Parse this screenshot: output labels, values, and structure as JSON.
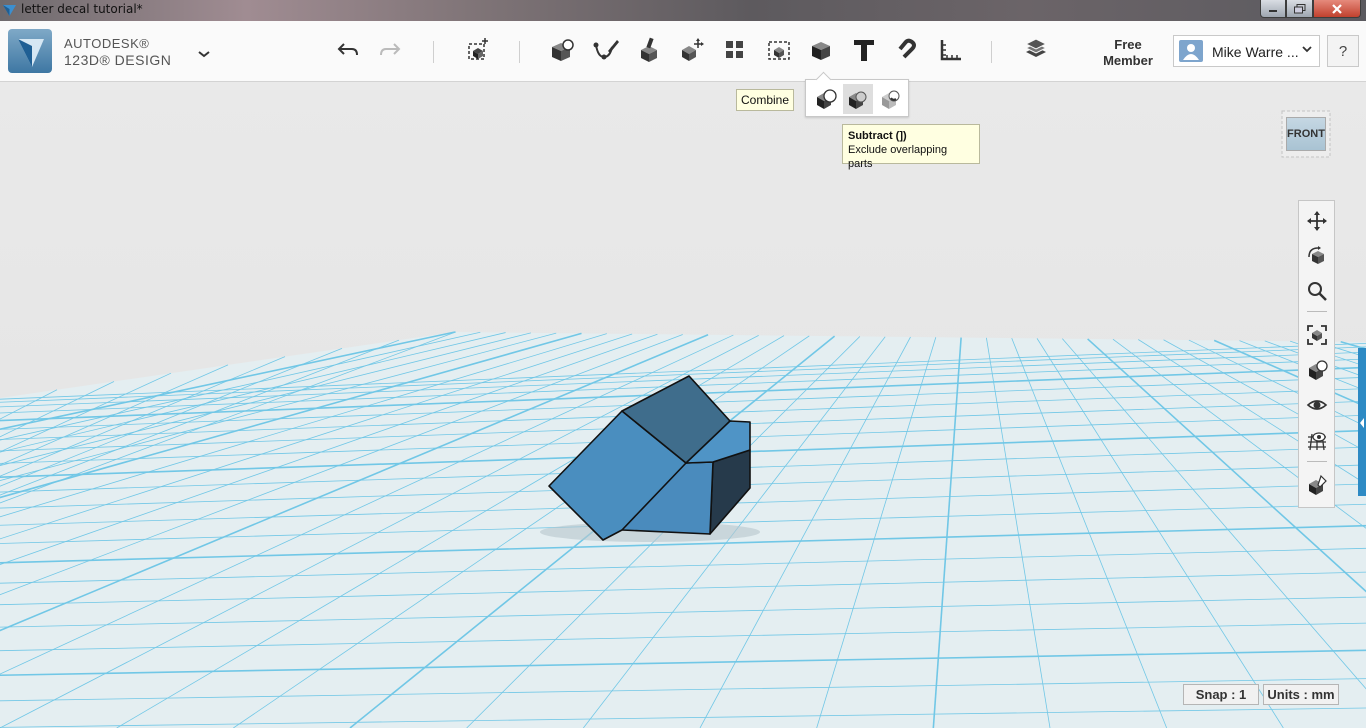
{
  "window": {
    "title": "letter decal tutorial*"
  },
  "brand": {
    "line1": "AUTODESK®",
    "line2": "123D® DESIGN"
  },
  "toolbar": {
    "tools": [
      {
        "name": "undo",
        "icon": "undo-icon"
      },
      {
        "name": "redo",
        "icon": "redo-icon"
      },
      {
        "name": "primitives",
        "icon": "primitives-icon"
      },
      {
        "name": "sketch",
        "icon": "sketch-icon"
      },
      {
        "name": "construct",
        "icon": "construct-icon"
      },
      {
        "name": "modify",
        "icon": "modify-icon"
      },
      {
        "name": "pattern",
        "icon": "pattern-icon"
      },
      {
        "name": "group",
        "icon": "group-icon"
      },
      {
        "name": "combine",
        "icon": "combine-icon"
      },
      {
        "name": "text",
        "icon": "text-icon"
      },
      {
        "name": "snap",
        "icon": "snap-icon"
      },
      {
        "name": "measure",
        "icon": "measure-icon"
      },
      {
        "name": "materials",
        "icon": "materials-icon"
      }
    ],
    "free_member": "Free Member",
    "user_name": "Mike Warre ...",
    "help": "?"
  },
  "combine": {
    "tooltip": "Combine",
    "flyout_items": [
      "merge",
      "subtract",
      "intersect"
    ],
    "subtract_tooltip_title": "Subtract (])",
    "subtract_tooltip_desc": "Exclude overlapping parts"
  },
  "viewcube": {
    "face": "FRONT"
  },
  "nav_tools": [
    "pan-icon",
    "orbit-icon",
    "zoom-icon",
    "fit-icon",
    "view-model-icon",
    "visibility-icon",
    "grid-icon",
    "materials-view-icon"
  ],
  "status": {
    "snap": "Snap : 1",
    "units": "Units : mm"
  },
  "colors": {
    "accent": "#2d8ac4",
    "grid_line": "#71c7e6",
    "grid_bg": "#e4eef1",
    "solid_face": "#4a8bbd",
    "solid_top": "#3f6d8c",
    "solid_dark": "#263a4b"
  }
}
